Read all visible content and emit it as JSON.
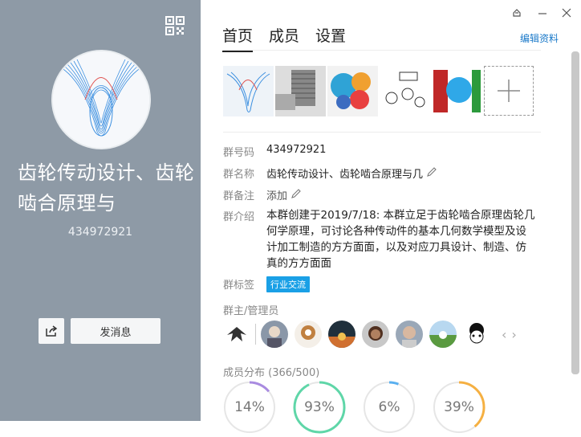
{
  "profile": {
    "group_name": "齿轮传动设计、齿轮啮合原理与",
    "group_number": "434972921",
    "send_message_label": "发消息"
  },
  "tabs": [
    {
      "label": "首页",
      "active": true
    },
    {
      "label": "成员",
      "active": false
    },
    {
      "label": "设置",
      "active": false
    }
  ],
  "edit_profile_label": "编辑资料",
  "info": {
    "group_number_label": "群号码",
    "group_number_value": "434972921",
    "group_name_label": "群名称",
    "group_name_value": "齿轮传动设计、齿轮啮合原理与几",
    "remark_label": "群备注",
    "remark_value": "添加",
    "intro_label": "群介绍",
    "intro_value": "本群创建于2019/7/18: 本群立足于齿轮啮合原理齿轮几何学原理，可讨论各种传动件的基本几何数学模型及设计加工制造的方方面面，以及对应刀具设计、制造、仿真的方方面面",
    "tags_label": "群标签",
    "tag_value": "行业交流"
  },
  "admins_title": "群主/管理员",
  "distribution": {
    "title": "成员分布 (366/500)",
    "rings": [
      {
        "label": "14%",
        "value": 0.14,
        "color": "#a98be0"
      },
      {
        "label": "93%",
        "value": 0.93,
        "color": "#5fd6a8"
      },
      {
        "label": "6%",
        "value": 0.06,
        "color": "#5ab0f0"
      },
      {
        "label": "39%",
        "value": 0.39,
        "color": "#f5b042"
      }
    ]
  },
  "colors": {
    "left_panel": "#8e9aa6",
    "accent_blue": "#1a79c9",
    "tag_blue": "#1aa0e6"
  }
}
